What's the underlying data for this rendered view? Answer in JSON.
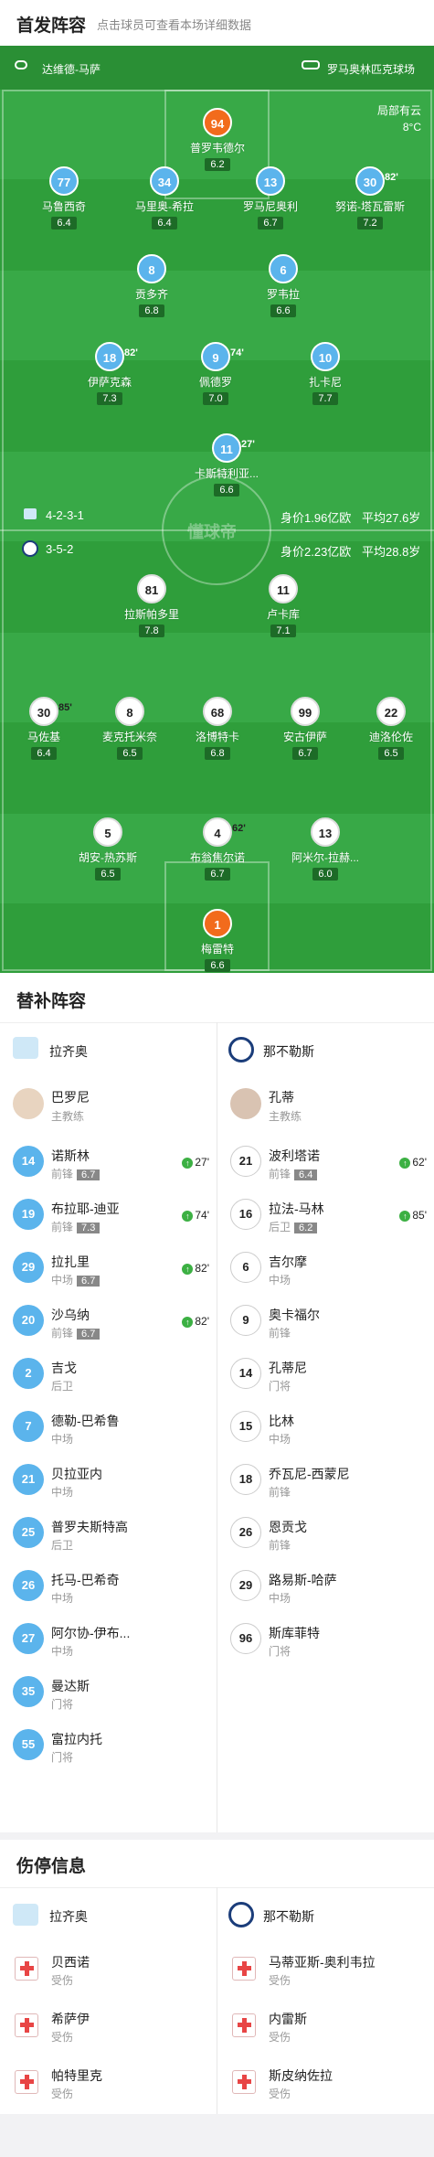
{
  "header": {
    "title": "首发阵容",
    "subtitle": "点击球员可查看本场详细数据"
  },
  "venue": {
    "home": "达维德-马萨",
    "stadium": "罗马奥林匹克球场",
    "weather_line1": "局部有云",
    "weather_line2": "8°C",
    "watermark": "懂球帝"
  },
  "lazio_form": {
    "formation": "4-2-3-1",
    "value": "身价1.96亿欧",
    "age": "平均27.6岁"
  },
  "napoli_form": {
    "formation": "3-5-2",
    "value": "身价2.23亿欧",
    "age": "平均28.8岁"
  },
  "lazio_players": [
    {
      "num": "94",
      "name": "普罗韦德尔",
      "rating": "6.2"
    },
    {
      "num": "77",
      "name": "马鲁西奇",
      "rating": "6.4"
    },
    {
      "num": "34",
      "name": "马里奥-希拉",
      "rating": "6.4"
    },
    {
      "num": "13",
      "name": "罗马尼奥利",
      "rating": "6.7"
    },
    {
      "num": "30",
      "name": "努诺-塔瓦雷斯",
      "rating": "7.2",
      "subtime": "82'"
    },
    {
      "num": "8",
      "name": "贡多齐",
      "rating": "6.8"
    },
    {
      "num": "6",
      "name": "罗韦拉",
      "rating": "6.6"
    },
    {
      "num": "18",
      "name": "伊萨克森",
      "rating": "7.3",
      "subtime": "82'"
    },
    {
      "num": "9",
      "name": "佩德罗",
      "rating": "7.0",
      "subtime": "74'"
    },
    {
      "num": "10",
      "name": "扎卡尼",
      "rating": "7.7"
    },
    {
      "num": "11",
      "name": "卡斯特利亚...",
      "rating": "6.6",
      "subtime": "27'"
    }
  ],
  "napoli_players": [
    {
      "num": "81",
      "name": "拉斯帕多里",
      "rating": "7.8"
    },
    {
      "num": "11",
      "name": "卢卡库",
      "rating": "7.1"
    },
    {
      "num": "30",
      "name": "马佐基",
      "rating": "6.4",
      "subtime": "85'"
    },
    {
      "num": "8",
      "name": "麦克托米奈",
      "rating": "6.5"
    },
    {
      "num": "68",
      "name": "洛博特卡",
      "rating": "6.8"
    },
    {
      "num": "99",
      "name": "安古伊萨",
      "rating": "6.7"
    },
    {
      "num": "22",
      "name": "迪洛伦佐",
      "rating": "6.5"
    },
    {
      "num": "5",
      "name": "胡安-热苏斯",
      "rating": "6.5"
    },
    {
      "num": "4",
      "name": "布翁焦尔诺",
      "rating": "6.7",
      "subtime": "62'"
    },
    {
      "num": "13",
      "name": "阿米尔-拉赫...",
      "rating": "6.0"
    },
    {
      "num": "1",
      "name": "梅雷特",
      "rating": "6.6"
    }
  ],
  "subs": {
    "title": "替补阵容",
    "home_team": "拉齐奥",
    "away_team": "那不勒斯",
    "home_coach": {
      "name": "巴罗尼",
      "role": "主教练"
    },
    "away_coach": {
      "name": "孔蒂",
      "role": "主教练"
    },
    "home": [
      {
        "num": "14",
        "name": "诺斯林",
        "pos": "前锋",
        "rating": "6.7",
        "time": "27'"
      },
      {
        "num": "19",
        "name": "布拉耶-迪亚",
        "pos": "前锋",
        "rating": "7.3",
        "time": "74'"
      },
      {
        "num": "29",
        "name": "拉扎里",
        "pos": "中场",
        "rating": "6.7",
        "time": "82'"
      },
      {
        "num": "20",
        "name": "沙乌纳",
        "pos": "前锋",
        "rating": "6.7",
        "time": "82'"
      },
      {
        "num": "2",
        "name": "吉戈",
        "pos": "后卫"
      },
      {
        "num": "7",
        "name": "德勒-巴希鲁",
        "pos": "中场"
      },
      {
        "num": "21",
        "name": "贝拉亚内",
        "pos": "中场"
      },
      {
        "num": "25",
        "name": "普罗夫斯特高",
        "pos": "后卫"
      },
      {
        "num": "26",
        "name": "托马-巴希奇",
        "pos": "中场"
      },
      {
        "num": "27",
        "name": "阿尔协-伊布...",
        "pos": "中场"
      },
      {
        "num": "35",
        "name": "曼达斯",
        "pos": "门将"
      },
      {
        "num": "55",
        "name": "富拉内托",
        "pos": "门将"
      }
    ],
    "away": [
      {
        "num": "21",
        "name": "波利塔诺",
        "pos": "前锋",
        "rating": "6.4",
        "time": "62'"
      },
      {
        "num": "16",
        "name": "拉法-马林",
        "pos": "后卫",
        "rating": "6.2",
        "time": "85'"
      },
      {
        "num": "6",
        "name": "吉尔摩",
        "pos": "中场"
      },
      {
        "num": "9",
        "name": "奥卡福尔",
        "pos": "前锋"
      },
      {
        "num": "14",
        "name": "孔蒂尼",
        "pos": "门将"
      },
      {
        "num": "15",
        "name": "比林",
        "pos": "中场"
      },
      {
        "num": "18",
        "name": "乔瓦尼-西蒙尼",
        "pos": "前锋"
      },
      {
        "num": "26",
        "name": "恩贡戈",
        "pos": "前锋"
      },
      {
        "num": "29",
        "name": "路易斯-哈萨",
        "pos": "中场"
      },
      {
        "num": "96",
        "name": "斯库菲特",
        "pos": "门将"
      }
    ]
  },
  "injuries": {
    "title": "伤停信息",
    "home_team": "拉齐奥",
    "away_team": "那不勒斯",
    "home": [
      {
        "name": "贝西诺",
        "status": "受伤"
      },
      {
        "name": "希萨伊",
        "status": "受伤"
      },
      {
        "name": "帕特里克",
        "status": "受伤"
      }
    ],
    "away": [
      {
        "name": "马蒂亚斯-奥利韦拉",
        "status": "受伤"
      },
      {
        "name": "内雷斯",
        "status": "受伤"
      },
      {
        "name": "斯皮纳佐拉",
        "status": "受伤"
      }
    ]
  },
  "colors": {
    "pitch": "#2f9e3b",
    "lazio": "#5bb4ec",
    "napoli": "#ffffff",
    "gk_home": "#f26b1c",
    "gk_away": "#f26b1c",
    "sub_in": "#3cb043"
  }
}
